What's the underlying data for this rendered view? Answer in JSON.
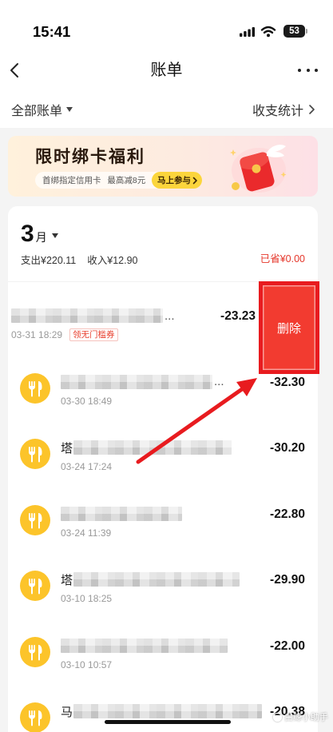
{
  "status_bar": {
    "time": "15:41",
    "battery": "53",
    "icons": [
      "cellular-signal-icon",
      "wifi-icon",
      "battery-icon"
    ]
  },
  "header": {
    "title": "账单",
    "back_icon": "chevron-left-icon",
    "more_icon": "more-icon"
  },
  "filters": {
    "all_bills": "全部账单",
    "all_bills_icon": "caret-down-icon",
    "stats": "收支统计",
    "stats_icon": "chevron-right-icon"
  },
  "banner": {
    "title": "限时绑卡福利",
    "desc": "首绑指定信用卡 最高减8元",
    "cta": "马上参与",
    "illustration": "red-envelope-illustration"
  },
  "summary": {
    "month": "3",
    "month_unit": "月",
    "expense": "支出¥220.11",
    "income": "收入¥12.90",
    "saved": "已省¥0.00"
  },
  "transactions": [
    {
      "name_suffix": "...",
      "date": "03-31 18:29",
      "tag": "领无门槛券",
      "amount": "-23.23",
      "swiped_open": true
    },
    {
      "icon": "fork-knife-icon",
      "name_suffix": "...",
      "date": "03-30 18:49",
      "amount": "-32.30"
    },
    {
      "icon": "fork-knife-icon",
      "name_visible": "塔",
      "date": "03-24 17:24",
      "amount": "-30.20"
    },
    {
      "icon": "fork-knife-icon",
      "date": "03-24 11:39",
      "amount": "-22.80"
    },
    {
      "icon": "fork-knife-icon",
      "name_visible": "塔",
      "date": "03-10 18:25",
      "amount": "-29.90"
    },
    {
      "icon": "fork-knife-icon",
      "date": "03-10 10:57",
      "amount": "-22.00"
    },
    {
      "icon": "fork-knife-icon",
      "name_visible": "马",
      "amount": "-20.38"
    }
  ],
  "swipe_action": {
    "delete_label": "删除"
  },
  "watermark": "白鲸小助手",
  "colors": {
    "saved_red": "#e5362a",
    "merchant_icon_yellow": "#fcc42a",
    "delete_red": "#f23b30",
    "annotation_red": "#e81b1f",
    "cta_yellow": "#fbd53c",
    "page_background": "#f4f4f4"
  }
}
